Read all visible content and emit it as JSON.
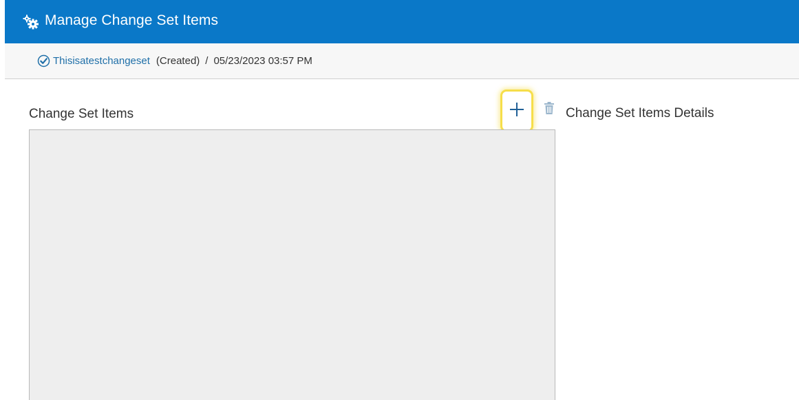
{
  "header": {
    "title": "Manage Change Set Items",
    "icon": "gears-icon",
    "background": "#0a78c8"
  },
  "breadcrumb": {
    "status_icon": "check-circle-icon",
    "change_set_name": "Thisisatestchangeset",
    "status": "(Created)",
    "separator": "/",
    "timestamp": "05/23/2023 03:57 PM"
  },
  "main": {
    "items_label": "Change Set Items",
    "details_label": "Change Set Items Details",
    "add_icon": "plus-icon",
    "delete_icon": "trash-icon",
    "highlight_color": "#f6de4a",
    "panel_background": "#eeeeee"
  }
}
